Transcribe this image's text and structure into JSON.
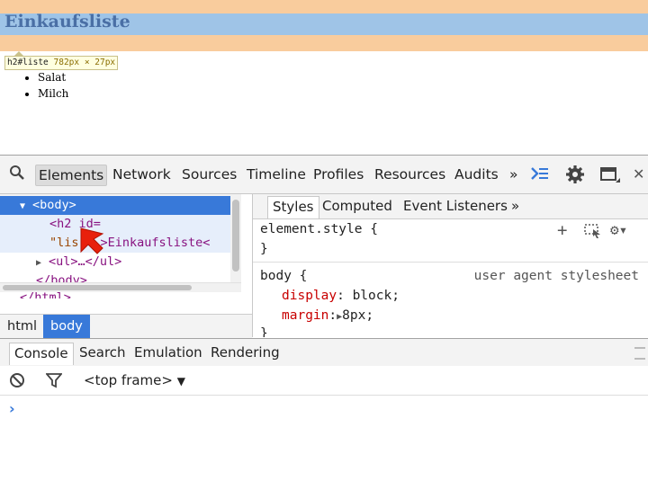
{
  "page": {
    "heading": "Einkaufsliste",
    "tooltip_selector": "h2#liste",
    "tooltip_size": "782px × 27px",
    "list_items": [
      "Salat",
      "Milch"
    ]
  },
  "devtools": {
    "tabs": [
      "Elements",
      "Network",
      "Sources",
      "Timeline",
      "Profiles",
      "Resources",
      "Audits"
    ],
    "active_tab": "Elements",
    "more_tabs": "»",
    "tree": {
      "body_open": "<body>",
      "h2_line1": "<h2 id=",
      "h2_line2_start": "\"lis",
      "h2_line2_rest": ">Einkaufsliste<",
      "ul_line": "<ul>…</ul>",
      "body_close": "</body>",
      "html_close": "</html>"
    },
    "breadcrumbs": [
      "html",
      "body"
    ],
    "styles_tabs": [
      "Styles",
      "Computed",
      "Event Listeners"
    ],
    "styles_more": "»",
    "styles": {
      "element_style": "element.style {",
      "close_brace": "}",
      "body_selector": "body {",
      "ua_label": "user agent stylesheet",
      "props": [
        {
          "name": "display",
          "value": "block;"
        },
        {
          "name": "margin",
          "value": "8px;"
        }
      ]
    },
    "drawer_tabs": [
      "Console",
      "Search",
      "Emulation",
      "Rendering"
    ],
    "frame_selector": "<top frame>",
    "prompt": "›"
  },
  "colors": {
    "margin_overlay": "#f9cc9d",
    "content_overlay": "#9fc4e7",
    "selection": "#3879d9",
    "cursor": "#e8200c"
  }
}
